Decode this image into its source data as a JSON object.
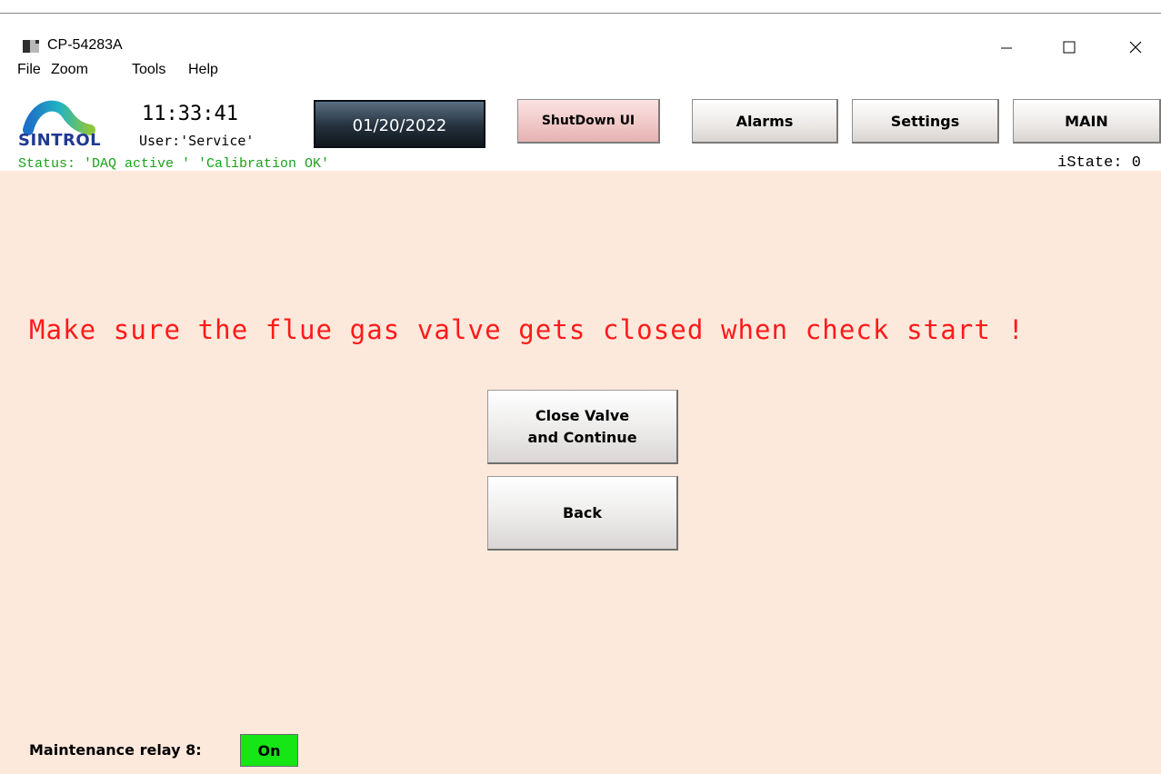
{
  "window": {
    "title": "CP-54283A",
    "icons": {
      "app": "app-window-icon",
      "minimize": "minimize-icon",
      "maximize": "maximize-icon",
      "close": "close-icon"
    }
  },
  "menu": {
    "items": [
      "File",
      "Zoom",
      "Tools",
      "Help"
    ]
  },
  "header": {
    "logo_text": "SINTROL",
    "time": "11:33:41",
    "user": "User:'Service'",
    "date": "01/20/2022",
    "buttons": {
      "shutdown": "ShutDown UI",
      "alarms": "Alarms",
      "settings": "Settings",
      "main": "MAIN"
    },
    "status": "Status: 'DAQ active ' 'Calibration OK'",
    "istate": "iState: 0"
  },
  "main": {
    "warning": "Make sure the flue gas valve gets closed when check start !",
    "close_valve": {
      "line1": "Close Valve",
      "line2": "and Continue"
    },
    "back": "Back"
  },
  "footer": {
    "relay_label": "Maintenance relay 8:",
    "relay_state": "On"
  },
  "colors": {
    "background": "#fde9dc",
    "warning_text": "#ff1a1a",
    "status_text": "#1aa31a",
    "relay_on": "#16e516",
    "logo_text": "#1f3a93"
  }
}
